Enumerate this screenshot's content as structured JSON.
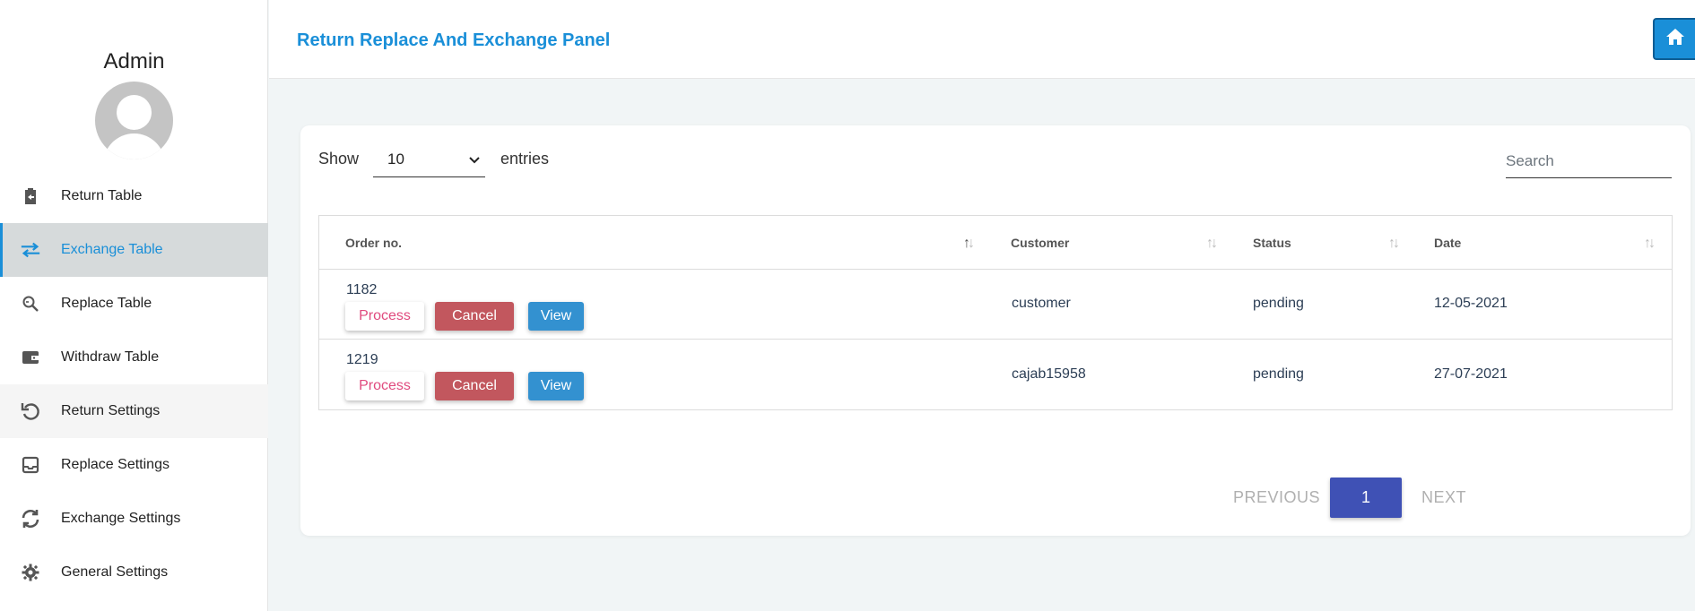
{
  "app": {
    "title": "Return Replace And Exchange Panel",
    "accent_color": "#1a8fd8"
  },
  "sidebar": {
    "user_name": "Admin",
    "items": [
      {
        "label": "Return Table",
        "icon": "clipboard-return-icon"
      },
      {
        "label": "Exchange Table",
        "icon": "swap-arrows-icon",
        "active": true
      },
      {
        "label": "Replace Table",
        "icon": "search-refresh-icon"
      },
      {
        "label": "Withdraw Table",
        "icon": "wallet-icon"
      },
      {
        "label": "Return Settings",
        "icon": "undo-icon"
      },
      {
        "label": "Replace Settings",
        "icon": "inbox-icon"
      },
      {
        "label": "Exchange Settings",
        "icon": "sync-icon"
      },
      {
        "label": "General Settings",
        "icon": "gear-icon"
      }
    ]
  },
  "header": {
    "home_icon": "home-icon"
  },
  "controls": {
    "show_label": "Show",
    "page_size": "10",
    "entries_label": "entries",
    "search_placeholder": "Search"
  },
  "table": {
    "columns": [
      "Order no.",
      "Customer",
      "Status",
      "Date"
    ],
    "rows": [
      {
        "order_no": "1182",
        "customer": "customer",
        "status": "pending",
        "date": "12-05-2021"
      },
      {
        "order_no": "1219",
        "customer": "cajab15958",
        "status": "pending",
        "date": "27-07-2021"
      }
    ],
    "actions": {
      "process": "Process",
      "cancel": "Cancel",
      "view": "View"
    }
  },
  "pagination": {
    "previous": "PREVIOUS",
    "current_page": "1",
    "next": "NEXT"
  }
}
